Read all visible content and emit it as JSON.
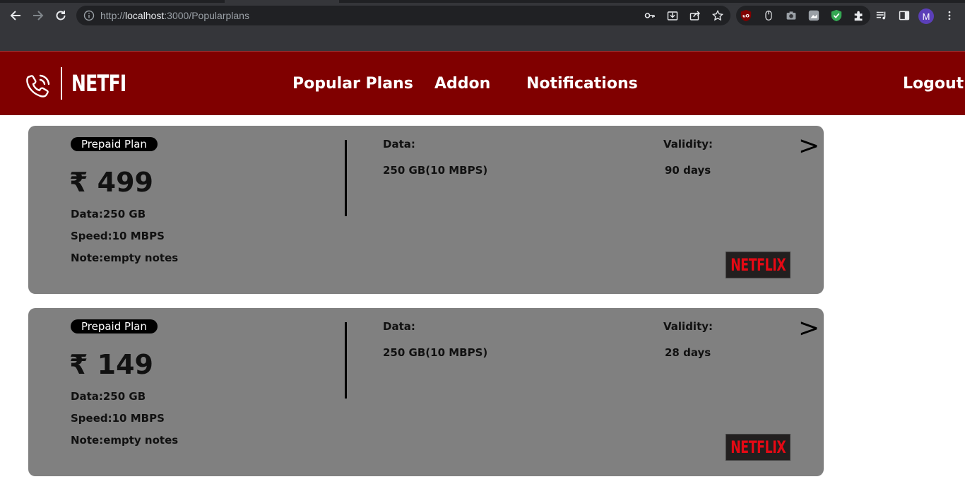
{
  "browser": {
    "url_prefix": "http://",
    "url_host": "localhost",
    "url_path": ":3000/Popularplans",
    "profile_initial": "M"
  },
  "navbar": {
    "brand": "NETFI",
    "links": [
      "Popular Plans",
      "Addon",
      "Notifications"
    ],
    "logout": "Logout"
  },
  "plans": [
    {
      "type": "Prepaid Plan",
      "price": "₹ 499",
      "data_line": "Data:250 GB",
      "speed_line": "Speed:10 MBPS",
      "note_line": "Note:empty notes",
      "data_label": "Data:",
      "data_value": "250 GB(10 MBPS)",
      "validity_label": "Validity:",
      "validity_value": "90 days",
      "arrow": ">",
      "ott_logo": "NETFLIX"
    },
    {
      "type": "Prepaid Plan",
      "price": "₹ 149",
      "data_line": "Data:250 GB",
      "speed_line": "Speed:10 MBPS",
      "note_line": "Note:empty notes",
      "data_label": "Data:",
      "data_value": "250 GB(10 MBPS)",
      "validity_label": "Validity:",
      "validity_value": "28 days",
      "arrow": ">",
      "ott_logo": "NETFLIX"
    }
  ]
}
